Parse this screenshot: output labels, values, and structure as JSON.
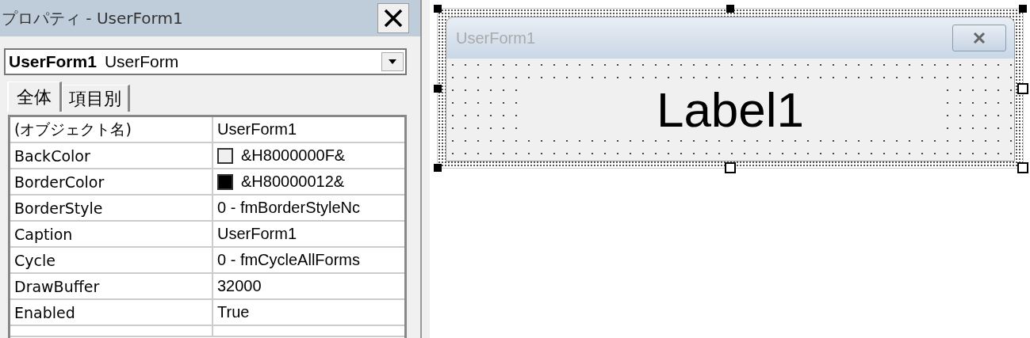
{
  "properties_window": {
    "title": "プロパティ - UserForm1",
    "object_selector": {
      "name": "UserForm1",
      "type": "UserForm"
    },
    "tabs": [
      {
        "label": "全体",
        "selected": true
      },
      {
        "label": "項目別",
        "selected": false
      }
    ],
    "properties": [
      {
        "name": "(オブジェクト名)",
        "value": "UserForm1"
      },
      {
        "name": "BackColor",
        "value": "&H8000000F&",
        "color": "#f0f0f0"
      },
      {
        "name": "BorderColor",
        "value": "&H80000012&",
        "color": "#000000"
      },
      {
        "name": "BorderStyle",
        "value": "0 - fmBorderStyleNc"
      },
      {
        "name": "Caption",
        "value": "UserForm1"
      },
      {
        "name": "Cycle",
        "value": "0 - fmCycleAllForms"
      },
      {
        "name": "DrawBuffer",
        "value": "32000"
      },
      {
        "name": "Enabled",
        "value": "True"
      }
    ]
  },
  "designer": {
    "form_caption": "UserForm1",
    "label": "Label1"
  }
}
